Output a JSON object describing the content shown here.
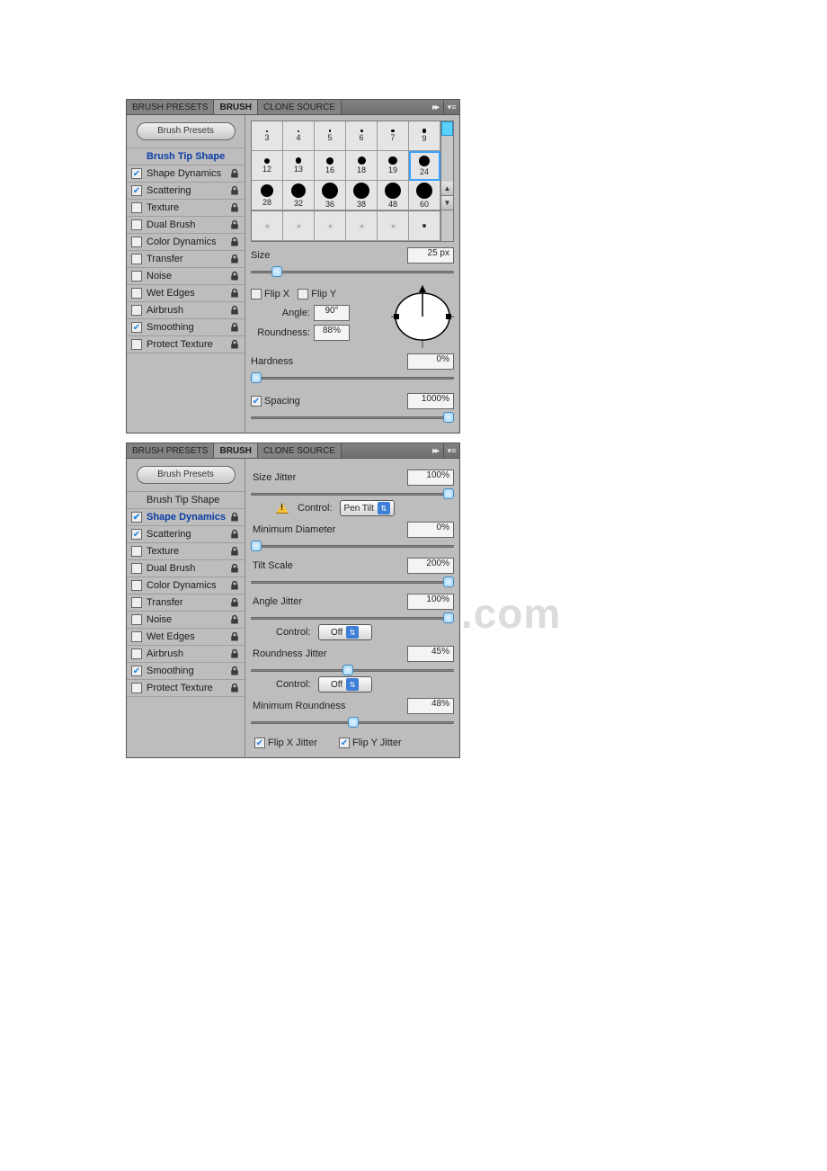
{
  "watermark": "www.bdocx.com",
  "tabs": {
    "brush_presets": "BRUSH PRESETS",
    "brush": "BRUSH",
    "clone_source": "CLONE SOURCE"
  },
  "sidebar": {
    "presets_button": "Brush Presets",
    "items": [
      {
        "label": "Brush Tip Shape",
        "checked": null
      },
      {
        "label": "Shape Dynamics",
        "checked": true
      },
      {
        "label": "Scattering",
        "checked": true
      },
      {
        "label": "Texture",
        "checked": false
      },
      {
        "label": "Dual Brush",
        "checked": false
      },
      {
        "label": "Color Dynamics",
        "checked": false
      },
      {
        "label": "Transfer",
        "checked": false
      },
      {
        "label": "Noise",
        "checked": false
      },
      {
        "label": "Wet Edges",
        "checked": false
      },
      {
        "label": "Airbrush",
        "checked": false
      },
      {
        "label": "Smoothing",
        "checked": true
      },
      {
        "label": "Protect Texture",
        "checked": false
      }
    ]
  },
  "panel1": {
    "brushes": [
      3,
      4,
      5,
      6,
      7,
      9,
      12,
      13,
      16,
      18,
      19,
      24,
      28,
      32,
      36,
      38,
      48,
      60
    ],
    "selected_index": 11,
    "size_label": "Size",
    "size_value": "25 px",
    "flipx": "Flip X",
    "flipy": "Flip Y",
    "angle_label": "Angle:",
    "angle_value": "90°",
    "roundness_label": "Roundness:",
    "roundness_value": "88%",
    "hardness_label": "Hardness",
    "hardness_value": "0%",
    "spacing_label": "Spacing",
    "spacing_value": "1000%"
  },
  "panel2": {
    "size_jitter_label": "Size Jitter",
    "size_jitter_value": "100%",
    "control_label": "Control:",
    "size_control": "Pen Tilt",
    "min_diameter_label": "Minimum Diameter",
    "min_diameter_value": "0%",
    "tilt_scale_label": "Tilt Scale",
    "tilt_scale_value": "200%",
    "angle_jitter_label": "Angle Jitter",
    "angle_jitter_value": "100%",
    "angle_control": "Off",
    "roundness_jitter_label": "Roundness Jitter",
    "roundness_jitter_value": "45%",
    "roundness_control": "Off",
    "min_roundness_label": "Minimum Roundness",
    "min_roundness_value": "48%",
    "flipx_jitter": "Flip X Jitter",
    "flipy_jitter": "Flip Y Jitter"
  }
}
